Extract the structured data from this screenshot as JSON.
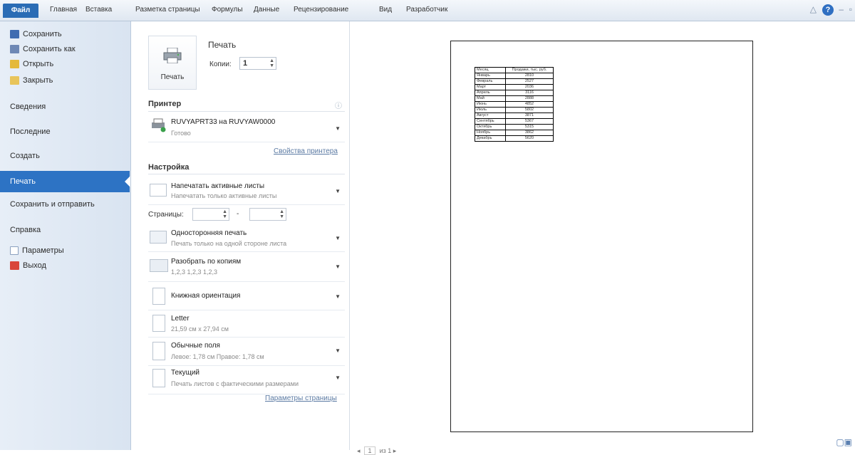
{
  "ribbon": {
    "file": "Файл",
    "tabs": [
      "Главная",
      "Вставка",
      "Разметка страницы",
      "Формулы",
      "Данные",
      "Рецензирование",
      "Вид",
      "Разработчик"
    ]
  },
  "nav": {
    "save": "Сохранить",
    "save_as": "Сохранить как",
    "open": "Открыть",
    "close": "Закрыть",
    "info": "Сведения",
    "recent": "Последние",
    "create": "Создать",
    "print": "Печать",
    "save_send": "Сохранить и отправить",
    "help": "Справка",
    "options": "Параметры",
    "exit": "Выход"
  },
  "print_panel": {
    "print_button": "Печать",
    "title": "Печать",
    "copies_label": "Копии:",
    "copies_value": "1"
  },
  "printer": {
    "section": "Принтер",
    "name": "RUVYAPRT33 на RUVYAW0000",
    "status": "Готово",
    "properties_link": "Свойства принтера"
  },
  "settings": {
    "section": "Настройка",
    "print_what": {
      "title": "Напечатать активные листы",
      "subtitle": "Напечатать только активные листы"
    },
    "pages_label": "Страницы:",
    "pages_sep": "-",
    "sides": {
      "title": "Односторонняя печать",
      "subtitle": "Печать только на одной стороне листа"
    },
    "collate": {
      "title": "Разобрать по копиям",
      "subtitle": "1,2,3   1,2,3   1,2,3"
    },
    "orientation": {
      "title": "Книжная ориентация"
    },
    "paper": {
      "title": "Letter",
      "subtitle": "21,59 см x 27,94 см"
    },
    "margins": {
      "title": "Обычные поля",
      "subtitle": "Левое: 1,78 см    Правое: 1,78 см"
    },
    "scaling": {
      "title": "Текущий",
      "subtitle": "Печать листов с фактическими размерами"
    },
    "page_setup_link": "Параметры страницы"
  },
  "preview": {
    "table_header": [
      "Месяц",
      "Продажи, тыс. руб."
    ],
    "rows": [
      [
        "Январь",
        "2810"
      ],
      [
        "Февраль",
        "2527"
      ],
      [
        "Март",
        "2036"
      ],
      [
        "Апрель",
        "3116"
      ],
      [
        "Май",
        "2888"
      ],
      [
        "Июнь",
        "4852"
      ],
      [
        "Июль",
        "5802"
      ],
      [
        "Август",
        "3871"
      ],
      [
        "Сентябрь",
        "5367"
      ],
      [
        "Октябрь",
        "5315"
      ],
      [
        "Ноябрь",
        "3862"
      ],
      [
        "Декабрь",
        "5620"
      ]
    ],
    "pager": {
      "current": "1",
      "total": "из 1"
    }
  }
}
